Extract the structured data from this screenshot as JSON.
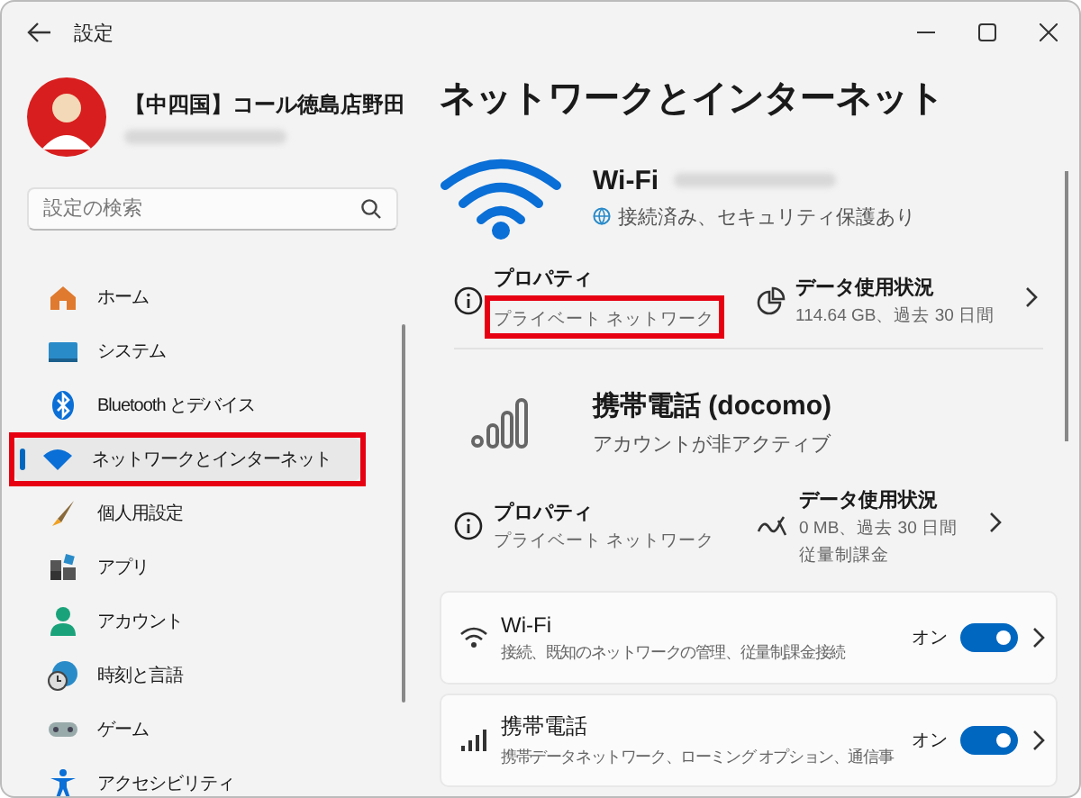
{
  "window": {
    "title": "設定"
  },
  "account": {
    "name": "【中四国】コール徳島店野田"
  },
  "search": {
    "placeholder": "設定の検索"
  },
  "sidebar": {
    "items": [
      {
        "label": "ホーム",
        "selected": false,
        "highlighted": false
      },
      {
        "label": "システム",
        "selected": false,
        "highlighted": false
      },
      {
        "label": "Bluetooth とデバイス",
        "selected": false,
        "highlighted": false
      },
      {
        "label": "ネットワークとインターネット",
        "selected": true,
        "highlighted": true
      },
      {
        "label": "個人用設定",
        "selected": false,
        "highlighted": false
      },
      {
        "label": "アプリ",
        "selected": false,
        "highlighted": false
      },
      {
        "label": "アカウント",
        "selected": false,
        "highlighted": false
      },
      {
        "label": "時刻と言語",
        "selected": false,
        "highlighted": false
      },
      {
        "label": "ゲーム",
        "selected": false,
        "highlighted": false
      },
      {
        "label": "アクセシビリティ",
        "selected": false,
        "highlighted": false
      }
    ]
  },
  "page": {
    "title": "ネットワークとインターネット"
  },
  "connections": [
    {
      "kind": "wifi",
      "name": "Wi-Fi",
      "status": "接続済み、セキュリティ保護あり",
      "properties": {
        "title": "プロパティ",
        "subtitle": "プライベート ネットワーク",
        "highlighted": true
      },
      "data_usage": {
        "title": "データ使用状況",
        "lines": [
          "114.64 GB、過去 30 日間"
        ]
      }
    },
    {
      "kind": "cellular",
      "name": "携帯電話 (docomo)",
      "status": "アカウントが非アクティブ",
      "properties": {
        "title": "プロパティ",
        "subtitle": "プライベート ネットワーク",
        "highlighted": false
      },
      "data_usage": {
        "title": "データ使用状況",
        "lines": [
          "0 MB、過去 30 日間",
          "従量制課金"
        ]
      }
    }
  ],
  "settings_cards": [
    {
      "kind": "wifi",
      "title": "Wi-Fi",
      "subtitle": "接続、既知のネットワークの管理、従量制課金接続",
      "toggle_label": "オン",
      "on": true
    },
    {
      "kind": "cellular",
      "title": "携帯電話",
      "subtitle": "携帯データネットワーク、ローミング オプション、通信事",
      "toggle_label": "オン",
      "on": true
    }
  ]
}
